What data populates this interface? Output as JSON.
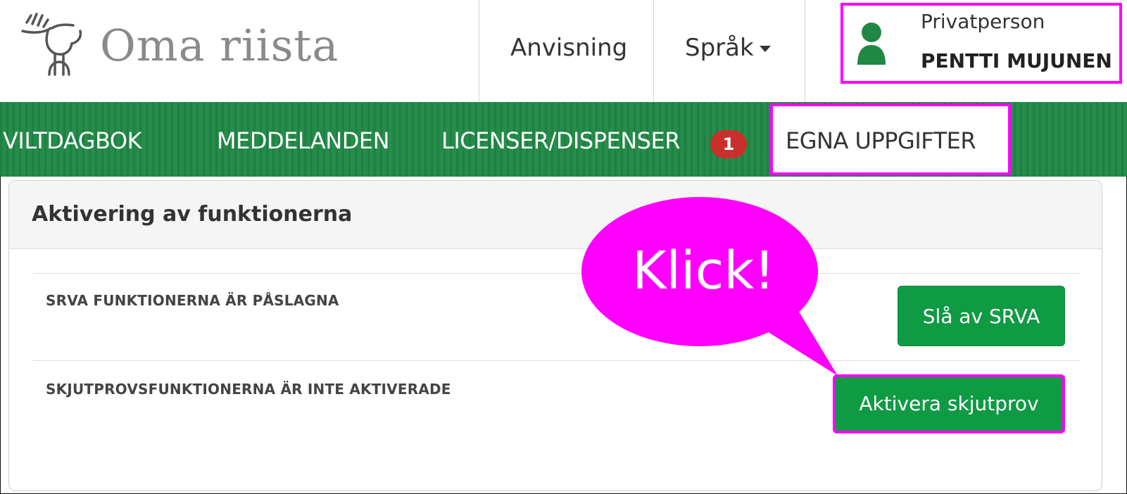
{
  "header": {
    "brand": "Oma riista",
    "links": {
      "help": "Anvisning",
      "language": "Språk"
    },
    "user": {
      "role": "Privatperson",
      "name": "PENTTI MUJUNEN"
    }
  },
  "nav": {
    "items": [
      {
        "label": "VILTDAGBOK"
      },
      {
        "label": "MEDDELANDEN"
      },
      {
        "label": "LICENSER/DISPENSER",
        "badge": "1"
      },
      {
        "label": "EGNA UPPGIFTER",
        "active": true
      }
    ]
  },
  "panel": {
    "title": "Aktivering av funktionerna",
    "rows": [
      {
        "label": "SRVA FUNKTIONERNA ÄR PÅSLAGNA",
        "button": "Slå av SRVA"
      },
      {
        "label": "SKJUTPROVSFUNKTIONERNA ÄR INTE AKTIVERADE",
        "button": "Aktivera skjutprov"
      }
    ]
  },
  "annotation": {
    "callout_text": "Klick!"
  },
  "colors": {
    "nav_green": "#1f8844",
    "button_green": "#0f9a44",
    "highlight": "#ff00ff",
    "badge_red": "#c9302c",
    "brand_gray": "#8a8a8a"
  },
  "icons": {
    "logo": "moose-logo-icon",
    "user": "user-icon",
    "language_caret": "caret-down-icon"
  }
}
